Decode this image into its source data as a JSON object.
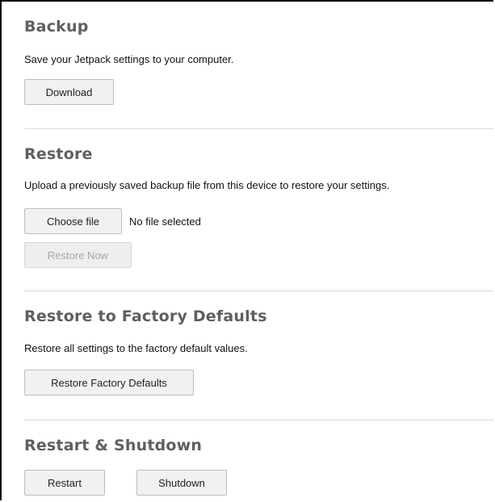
{
  "backup": {
    "title": "Backup",
    "description": "Save your Jetpack settings to your computer.",
    "download_label": "Download"
  },
  "restore": {
    "title": "Restore",
    "description": "Upload a previously saved backup file from this device to restore your settings.",
    "choose_file_label": "Choose file",
    "file_status": "No file selected",
    "restore_now_label": "Restore Now"
  },
  "factory": {
    "title": "Restore to Factory Defaults",
    "description": "Restore all settings to the factory default values.",
    "button_label": "Restore Factory Defaults"
  },
  "power": {
    "title": "Restart & Shutdown",
    "restart_label": "Restart",
    "shutdown_label": "Shutdown"
  }
}
